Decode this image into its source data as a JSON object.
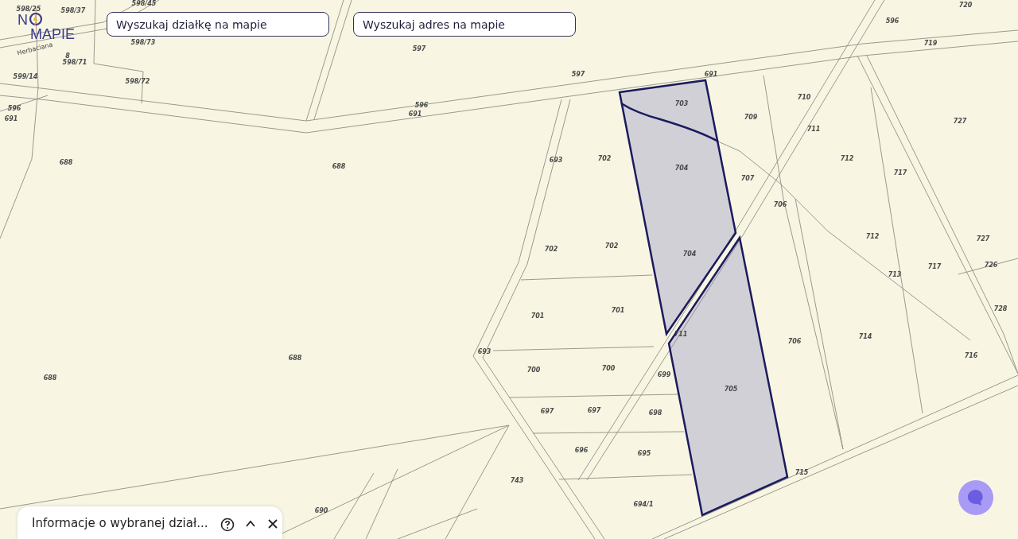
{
  "logo": {
    "first": "N",
    "second": "MAPIE"
  },
  "search_fields": [
    {
      "placeholder": "Wyszukaj działkę na mapie"
    },
    {
      "placeholder": "Wyszukaj adres na mapie"
    }
  ],
  "street_label": "Herbaciana",
  "parcel_labels": [
    "598/25",
    "598/37",
    "598/45",
    "598/73",
    "8",
    "598/71",
    "599/14",
    "598/72",
    "596",
    "691",
    "597",
    "597",
    "596",
    "691",
    "691",
    "596",
    "720",
    "719",
    "703",
    "709",
    "710",
    "711",
    "727",
    "688",
    "688",
    "693",
    "702",
    "704",
    "707",
    "712",
    "717",
    "706",
    "712",
    "727",
    "702",
    "702",
    "704",
    "726",
    "717",
    "713",
    "728",
    "701",
    "701",
    "711",
    "693",
    "706",
    "714",
    "716",
    "688",
    "688",
    "700",
    "700",
    "699",
    "705",
    "697",
    "697",
    "698",
    "696",
    "695",
    "743",
    "715",
    "694/1",
    "690"
  ],
  "info_panel": {
    "title": "Informacje o wybranej dział..."
  }
}
